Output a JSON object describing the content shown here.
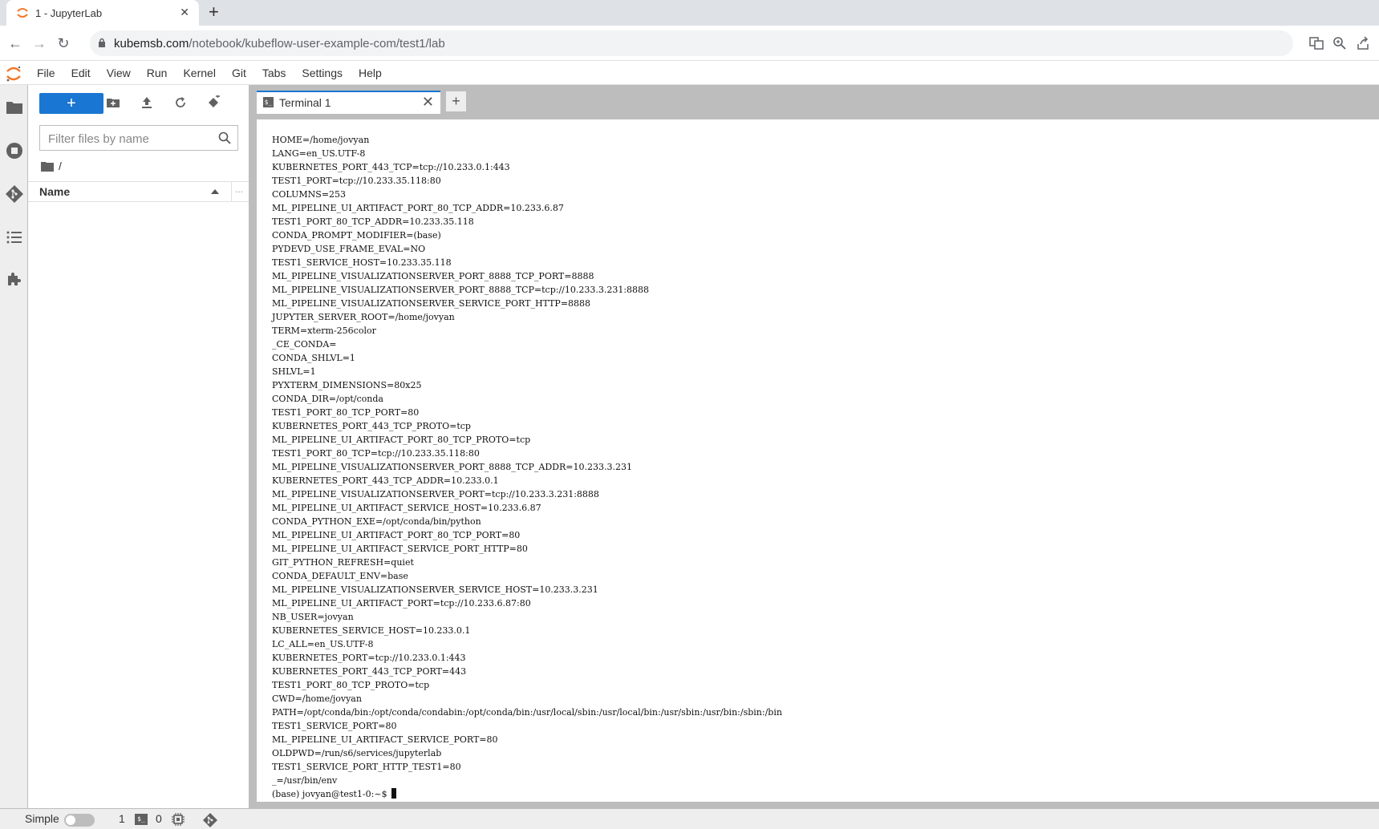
{
  "browser": {
    "tab_title": "1 - JupyterLab",
    "url_host": "kubemsb.com",
    "url_path": "/notebook/kubeflow-user-example-com/test1/lab"
  },
  "menubar": {
    "items": [
      "File",
      "Edit",
      "View",
      "Run",
      "Kernel",
      "Git",
      "Tabs",
      "Settings",
      "Help"
    ]
  },
  "filebrowser": {
    "new_label": "+",
    "filter_placeholder": "Filter files by name",
    "breadcrumb": "/",
    "column_name": "Name",
    "column_more": "..."
  },
  "dock": {
    "tab_label": "Terminal 1",
    "add_tab_label": "+"
  },
  "terminal": {
    "lines": [
      "HOME=/home/jovyan",
      "LANG=en_US.UTF-8",
      "KUBERNETES_PORT_443_TCP=tcp://10.233.0.1:443",
      "TEST1_PORT=tcp://10.233.35.118:80",
      "COLUMNS=253",
      "ML_PIPELINE_UI_ARTIFACT_PORT_80_TCP_ADDR=10.233.6.87",
      "TEST1_PORT_80_TCP_ADDR=10.233.35.118",
      "CONDA_PROMPT_MODIFIER=(base)",
      "PYDEVD_USE_FRAME_EVAL=NO",
      "TEST1_SERVICE_HOST=10.233.35.118",
      "ML_PIPELINE_VISUALIZATIONSERVER_PORT_8888_TCP_PORT=8888",
      "ML_PIPELINE_VISUALIZATIONSERVER_PORT_8888_TCP=tcp://10.233.3.231:8888",
      "ML_PIPELINE_VISUALIZATIONSERVER_SERVICE_PORT_HTTP=8888",
      "JUPYTER_SERVER_ROOT=/home/jovyan",
      "TERM=xterm-256color",
      "_CE_CONDA=",
      "CONDA_SHLVL=1",
      "SHLVL=1",
      "PYXTERM_DIMENSIONS=80x25",
      "CONDA_DIR=/opt/conda",
      "TEST1_PORT_80_TCP_PORT=80",
      "KUBERNETES_PORT_443_TCP_PROTO=tcp",
      "ML_PIPELINE_UI_ARTIFACT_PORT_80_TCP_PROTO=tcp",
      "TEST1_PORT_80_TCP=tcp://10.233.35.118:80",
      "ML_PIPELINE_VISUALIZATIONSERVER_PORT_8888_TCP_ADDR=10.233.3.231",
      "KUBERNETES_PORT_443_TCP_ADDR=10.233.0.1",
      "ML_PIPELINE_VISUALIZATIONSERVER_PORT=tcp://10.233.3.231:8888",
      "ML_PIPELINE_UI_ARTIFACT_SERVICE_HOST=10.233.6.87",
      "CONDA_PYTHON_EXE=/opt/conda/bin/python",
      "ML_PIPELINE_UI_ARTIFACT_PORT_80_TCP_PORT=80",
      "ML_PIPELINE_UI_ARTIFACT_SERVICE_PORT_HTTP=80",
      "GIT_PYTHON_REFRESH=quiet",
      "CONDA_DEFAULT_ENV=base",
      "ML_PIPELINE_VISUALIZATIONSERVER_SERVICE_HOST=10.233.3.231",
      "ML_PIPELINE_UI_ARTIFACT_PORT=tcp://10.233.6.87:80",
      "NB_USER=jovyan",
      "KUBERNETES_SERVICE_HOST=10.233.0.1",
      "LC_ALL=en_US.UTF-8",
      "KUBERNETES_PORT=tcp://10.233.0.1:443",
      "KUBERNETES_PORT_443_TCP_PORT=443",
      "TEST1_PORT_80_TCP_PROTO=tcp",
      "CWD=/home/jovyan",
      "PATH=/opt/conda/bin:/opt/conda/condabin:/opt/conda/bin:/usr/local/sbin:/usr/local/bin:/usr/sbin:/usr/bin:/sbin:/bin",
      "TEST1_SERVICE_PORT=80",
      "ML_PIPELINE_UI_ARTIFACT_SERVICE_PORT=80",
      "OLDPWD=/run/s6/services/jupyterlab",
      "TEST1_SERVICE_PORT_HTTP_TEST1=80",
      "_=/usr/bin/env"
    ],
    "prompt": "(base) jovyan@test1-0:~$ "
  },
  "statusbar": {
    "mode_label": "Simple",
    "terminals_count": "1",
    "kernels_count": "0"
  },
  "icons": {
    "activity": [
      "folder-icon",
      "running-icon",
      "git-icon",
      "toc-icon",
      "extension-icon"
    ],
    "toolbar": [
      "new-folder-icon",
      "upload-icon",
      "refresh-icon",
      "git-clone-icon"
    ]
  },
  "colors": {
    "accent": "#1976d2",
    "jupyter_orange": "#f37726"
  }
}
